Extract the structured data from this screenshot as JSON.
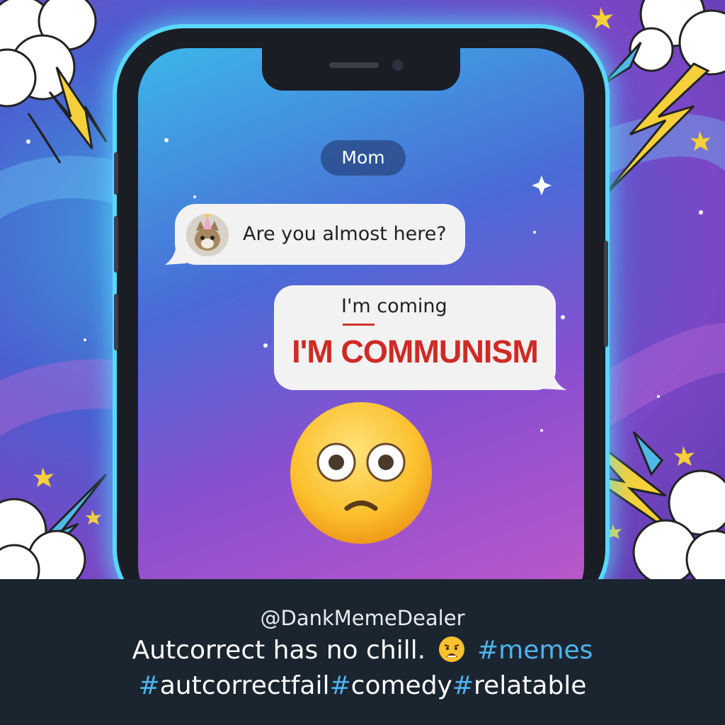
{
  "chat": {
    "contact_name": "Mom",
    "incoming": {
      "text": "Are you almost here?",
      "avatar_icon": "cat-party-hat-avatar"
    },
    "outgoing": {
      "typed_text": "I'm coming",
      "autocorrected_text": "I'M COMMUNISM"
    },
    "reaction_icon": "flushed-face-emoji"
  },
  "caption": {
    "handle": "@DankMemeDealer",
    "text": "Autcorrect has no chill.",
    "emoji_icon": "anguished-face-emoji",
    "hashtags": [
      "memes",
      "autcorrectfail",
      "comedy",
      "relatable"
    ]
  },
  "colors": {
    "accent_hashtag": "#4fb3f0",
    "autocorrect_red": "#cf2a25",
    "phone_glow": "#5ad8ff",
    "caption_bg": "#1b2530"
  }
}
